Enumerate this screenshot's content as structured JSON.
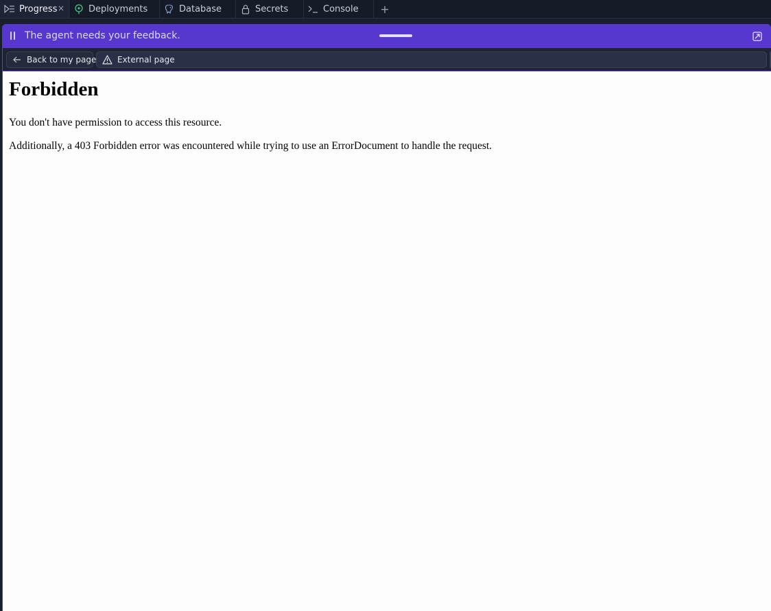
{
  "tabs": [
    {
      "label": "Progress",
      "icon": "progress-icon",
      "active": true,
      "closable": true
    },
    {
      "label": "Deployments",
      "icon": "deployments-icon",
      "active": false
    },
    {
      "label": "Database",
      "icon": "database-icon",
      "active": false
    },
    {
      "label": "Secrets",
      "icon": "lock-icon",
      "active": false
    },
    {
      "label": "Console",
      "icon": "terminal-icon",
      "active": false
    }
  ],
  "tab_add_label": "+",
  "tab_close_label": "×",
  "feedback": {
    "text": "The agent needs your feedback."
  },
  "nav": {
    "back_label": "Back to my page",
    "external_label": "External page"
  },
  "page": {
    "heading": "Forbidden",
    "paragraph1": "You don't have permission to access this resource.",
    "paragraph2": "Additionally, a 403 Forbidden error was encountered while trying to use an ErrorDocument to handle the request."
  },
  "colors": {
    "tabbar_bg": "#161b28",
    "feedback_bg": "#5638cf",
    "nav_bg": "#1e2436",
    "page_bg": "#fdfdfd"
  }
}
